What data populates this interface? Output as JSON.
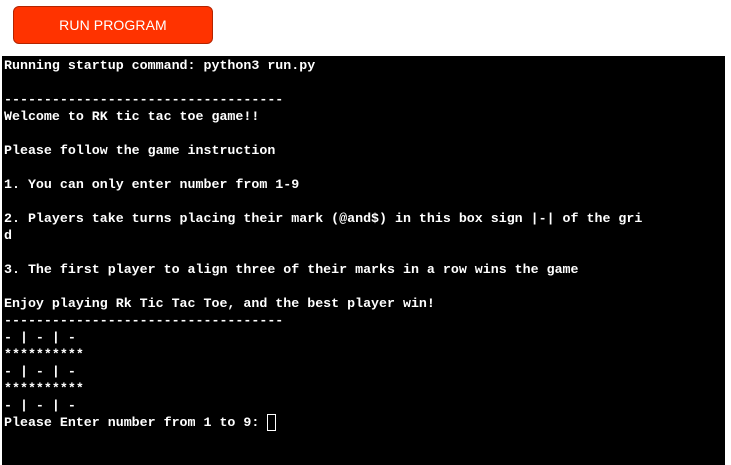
{
  "toolbar": {
    "run_label": "RUN PROGRAM"
  },
  "colors": {
    "button_bg": "#ff3300",
    "terminal_bg": "#000000",
    "terminal_fg": "#ffffff"
  },
  "terminal": {
    "lines": [
      "Running startup command: python3 run.py",
      "",
      "-----------------------------------",
      "Welcome to RK tic tac toe game!!",
      "",
      "Please follow the game instruction",
      "",
      "1. You can only enter number from 1-9",
      "",
      "2. Players take turns placing their mark (@and$) in this box sign |-| of the gri",
      "d",
      "",
      "3. The first player to align three of their marks in a row wins the game",
      "",
      "Enjoy playing Rk Tic Tac Toe, and the best player win!",
      "-----------------------------------",
      "- | - | -",
      "**********",
      "- | - | -",
      "**********",
      "- | - | -"
    ],
    "prompt": "Please Enter number from 1 to 9: "
  }
}
